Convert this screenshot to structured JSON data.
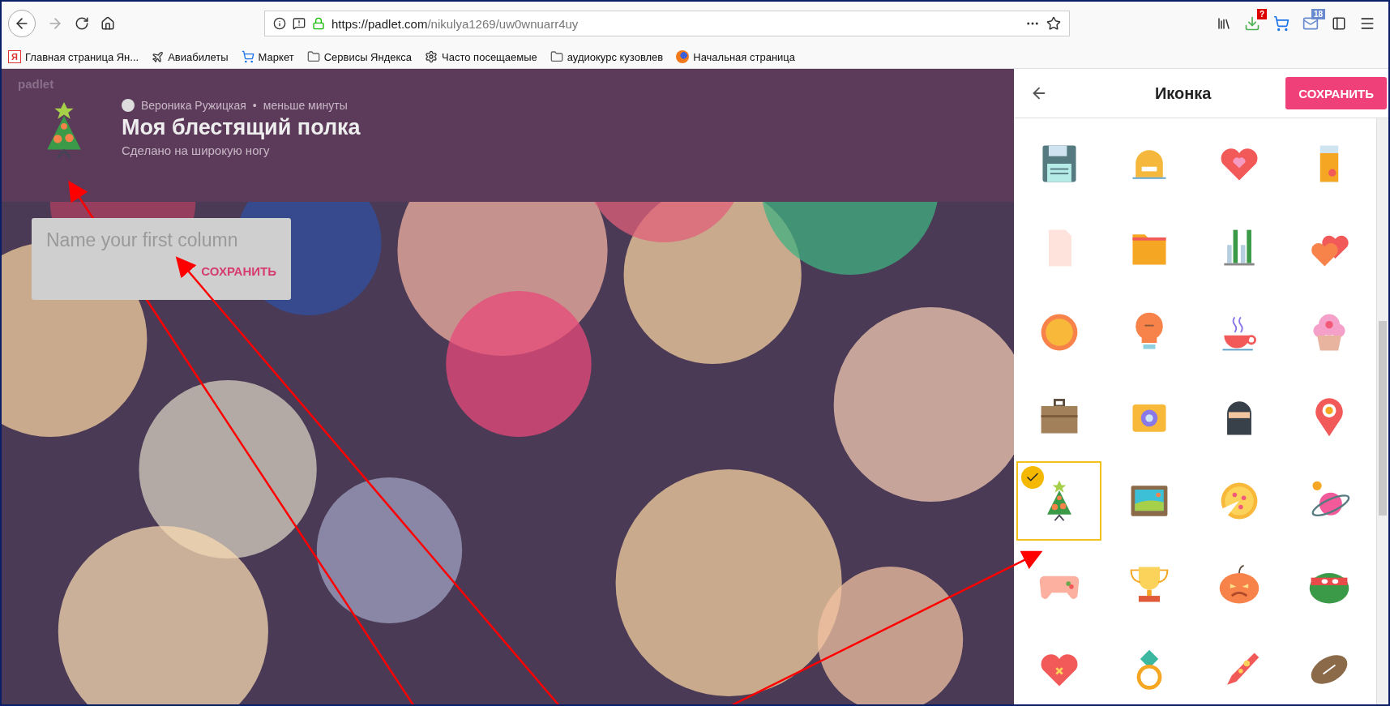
{
  "browser": {
    "url_host": "https://padlet.com",
    "url_path": "/nikulya1269/uw0wnuarr4uy",
    "downloads_badge": "?",
    "mail_badge": "18"
  },
  "bookmarks": [
    {
      "kind": "yandex",
      "logo_letter": "Я",
      "label": "Главная страница Ян..."
    },
    {
      "kind": "plane",
      "label": "Авиабилеты"
    },
    {
      "kind": "cart",
      "label": "Маркет"
    },
    {
      "kind": "folder",
      "label": "Сервисы Яндекса"
    },
    {
      "kind": "gear",
      "label": "Часто посещаемые"
    },
    {
      "kind": "folder",
      "label": "аудиокурс кузовлев"
    },
    {
      "kind": "firefox",
      "label": "Начальная страница"
    }
  ],
  "padlet": {
    "logo": "padlet",
    "author": "Вероника Ружицкая",
    "separator": "•",
    "time": "меньше минуты",
    "title": "Моя блестящий полка",
    "subtitle": "Сделано на широкую ногу"
  },
  "column_card": {
    "placeholder": "Name your first column",
    "button": "СОХРАНИТЬ"
  },
  "icon_panel": {
    "title": "Иконка",
    "save_button": "СОХРАНИТЬ",
    "icons": [
      {
        "kind": "floppy",
        "selected": false
      },
      {
        "kind": "face",
        "selected": false
      },
      {
        "kind": "heart",
        "selected": false
      },
      {
        "kind": "glass",
        "selected": false
      },
      {
        "kind": "document",
        "selected": false
      },
      {
        "kind": "folder",
        "selected": false
      },
      {
        "kind": "chart",
        "selected": false
      },
      {
        "kind": "hearts",
        "selected": false
      },
      {
        "kind": "sun",
        "selected": false
      },
      {
        "kind": "bulb",
        "selected": false
      },
      {
        "kind": "cup",
        "selected": false
      },
      {
        "kind": "cupcake",
        "selected": false
      },
      {
        "kind": "briefcase",
        "selected": false
      },
      {
        "kind": "camera",
        "selected": false
      },
      {
        "kind": "ninja",
        "selected": false
      },
      {
        "kind": "pin",
        "selected": false
      },
      {
        "kind": "tree",
        "selected": true
      },
      {
        "kind": "picture",
        "selected": false
      },
      {
        "kind": "pizza",
        "selected": false
      },
      {
        "kind": "planet",
        "selected": false
      },
      {
        "kind": "gamepad",
        "selected": false
      },
      {
        "kind": "trophy",
        "selected": false
      },
      {
        "kind": "pumpkin",
        "selected": false
      },
      {
        "kind": "turtle",
        "selected": false
      },
      {
        "kind": "heart-cross",
        "selected": false
      },
      {
        "kind": "ring",
        "selected": false
      },
      {
        "kind": "rocket",
        "selected": false
      },
      {
        "kind": "football",
        "selected": false
      }
    ]
  }
}
